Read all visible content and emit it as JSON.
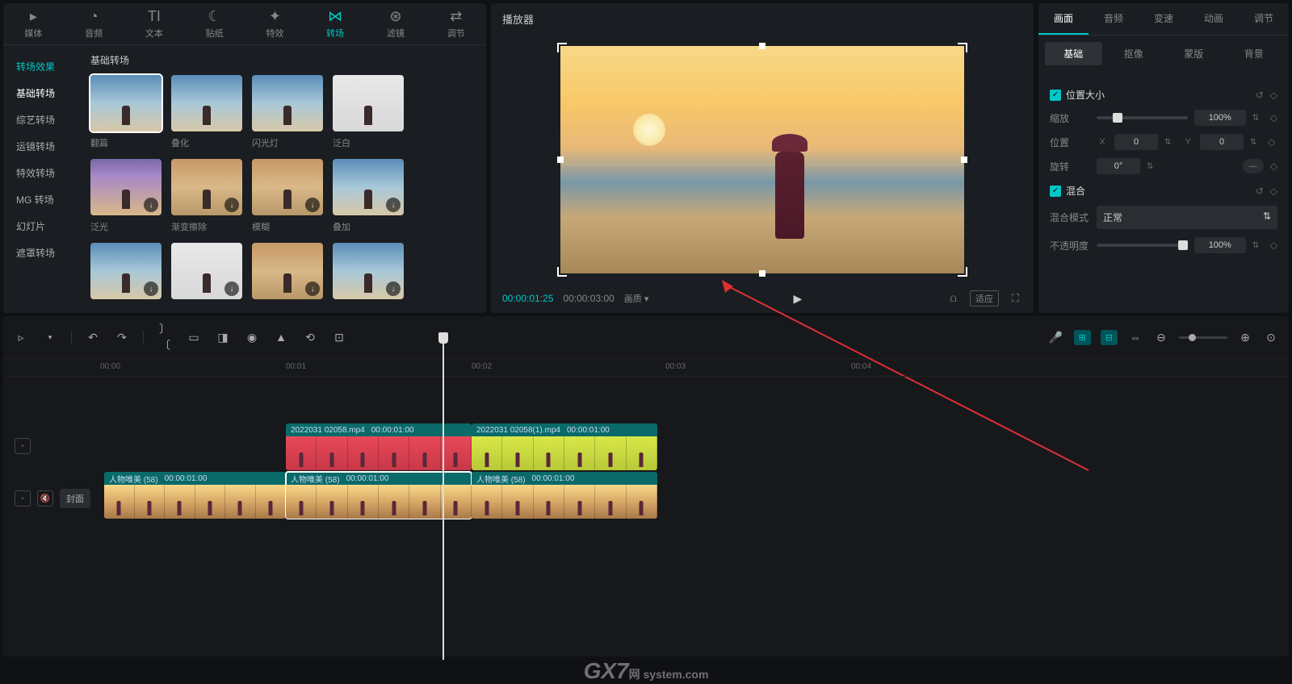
{
  "topTabs": [
    {
      "label": "媒体",
      "icon": "▸"
    },
    {
      "label": "音频",
      "icon": "◔"
    },
    {
      "label": "文本",
      "icon": "TI"
    },
    {
      "label": "贴纸",
      "icon": "☾"
    },
    {
      "label": "特效",
      "icon": "✦"
    },
    {
      "label": "转场",
      "icon": "⋈",
      "active": true
    },
    {
      "label": "滤镜",
      "icon": "⊛"
    },
    {
      "label": "调节",
      "icon": "⇄"
    }
  ],
  "sideNav": {
    "header": "转场效果",
    "items": [
      "基础转场",
      "综艺转场",
      "运镜转场",
      "特效转场",
      "MG 转场",
      "幻灯片",
      "遮罩转场"
    ]
  },
  "gridTitle": "基础转场",
  "thumbs": [
    {
      "label": "翻篇",
      "selected": true,
      "tone": ""
    },
    {
      "label": "叠化",
      "tone": ""
    },
    {
      "label": "闪光灯",
      "tone": ""
    },
    {
      "label": "泛白",
      "tone": "white"
    },
    {
      "label": "泛光",
      "dl": true,
      "tone": "purple"
    },
    {
      "label": "渐变擦除",
      "dl": true,
      "tone": "warm"
    },
    {
      "label": "模糊",
      "dl": true,
      "tone": "warm"
    },
    {
      "label": "叠加",
      "dl": true,
      "tone": ""
    },
    {
      "label": "",
      "dl": true,
      "tone": ""
    },
    {
      "label": "",
      "dl": true,
      "tone": "white"
    },
    {
      "label": "",
      "dl": true,
      "tone": "warm"
    },
    {
      "label": "",
      "dl": true,
      "tone": ""
    }
  ],
  "player": {
    "title": "播放器",
    "currentTime": "00:00:01:25",
    "totalTime": "00:00:03:00",
    "quality": "画质",
    "fitLabel": "适应"
  },
  "watermark": {
    "big": "GX7",
    "small": "网 system.com"
  },
  "propTabs": [
    "画面",
    "音频",
    "变速",
    "动画",
    "调节"
  ],
  "subTabs": [
    "基础",
    "抠像",
    "蒙版",
    "背景"
  ],
  "props": {
    "posSizeTitle": "位置大小",
    "scaleLabel": "缩放",
    "scaleValue": "100%",
    "positionLabel": "位置",
    "posX": "0",
    "posY": "0",
    "rotationLabel": "旋转",
    "rotationValue": "0°",
    "blendTitle": "混合",
    "blendModeLabel": "混合模式",
    "blendModeValue": "正常",
    "opacityLabel": "不透明度",
    "opacityValue": "100%"
  },
  "rulerTicks": [
    "00:00",
    "00:01",
    "00:02",
    "00:03",
    "00:04"
  ],
  "clips": {
    "v1a": {
      "name": "2022031 02058.mp4",
      "dur": "00:00:01:00"
    },
    "v1b": {
      "name": "2022031 02058(1).mp4",
      "dur": "00:00:01:00"
    },
    "v2a": {
      "name": "人物唯美 (58)",
      "dur": "00:00:01:00"
    },
    "v2b": {
      "name": "人物唯美 (58)",
      "dur": "00:00:01:00"
    },
    "v2c": {
      "name": "人物唯美 (58)",
      "dur": "00:00:01:00"
    }
  },
  "coverBtn": "封面"
}
